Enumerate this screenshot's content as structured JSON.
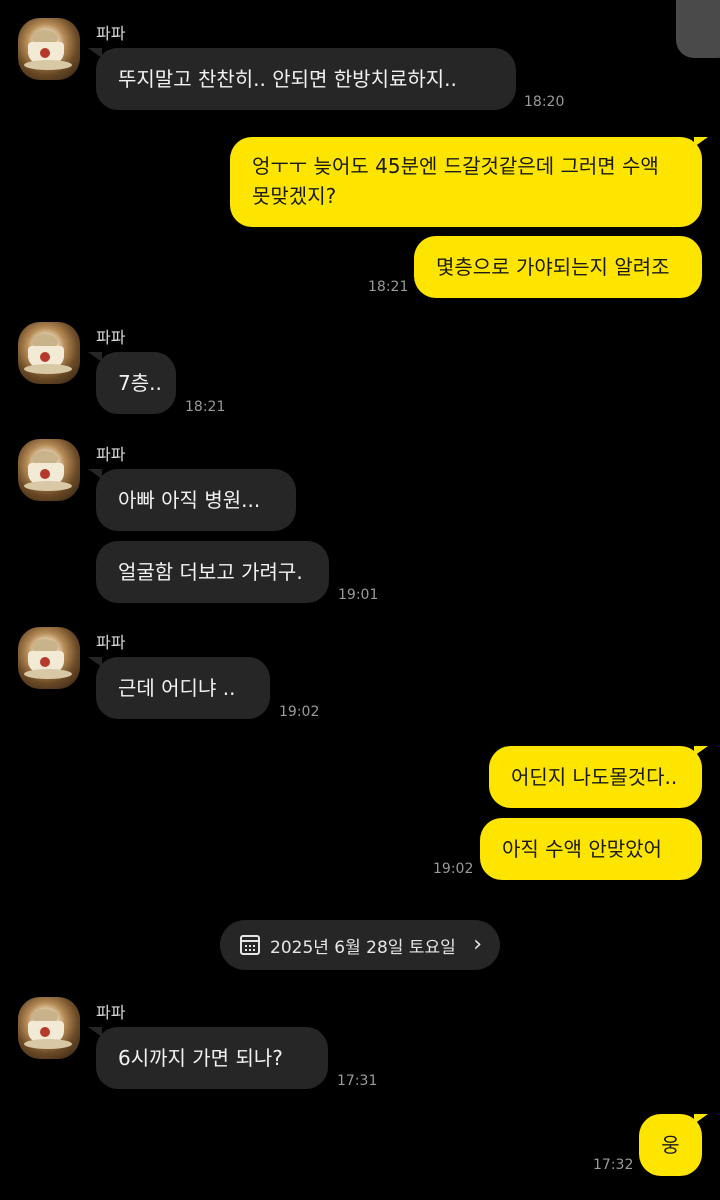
{
  "contact": {
    "name": "파파"
  },
  "messages": [
    {
      "text": "뚜지말고 찬찬히.. 안되면 한방치료하지..",
      "time": "18:20"
    },
    {
      "text": "엉ㅜㅜ 늦어도 45분엔 드갈것같은데 그러면 수액 못맞겠지?"
    },
    {
      "text": "몇층으로 가야되는지 알려조",
      "time": "18:21"
    },
    {
      "text": "7층..",
      "time": "18:21"
    },
    {
      "text": "아빠 아직 병원..."
    },
    {
      "text": "얼굴함 더보고 가려구.",
      "time": "19:01"
    },
    {
      "text": "근데 어디냐 ..",
      "time": "19:02"
    },
    {
      "text": "어딘지 나도몰것다.."
    },
    {
      "text": "아직 수액 안맞았어",
      "time": "19:02"
    },
    {
      "text": "6시까지 가면 되나?",
      "time": "17:31"
    },
    {
      "text": "웅",
      "time": "17:32"
    }
  ],
  "date_divider": {
    "label": "2025년 6월 28일 토요일",
    "icon": "calendar-icon",
    "chevron": "›"
  },
  "colors": {
    "background": "#000000",
    "incoming_bubble": "#262626",
    "outgoing_bubble": "#fee500"
  }
}
